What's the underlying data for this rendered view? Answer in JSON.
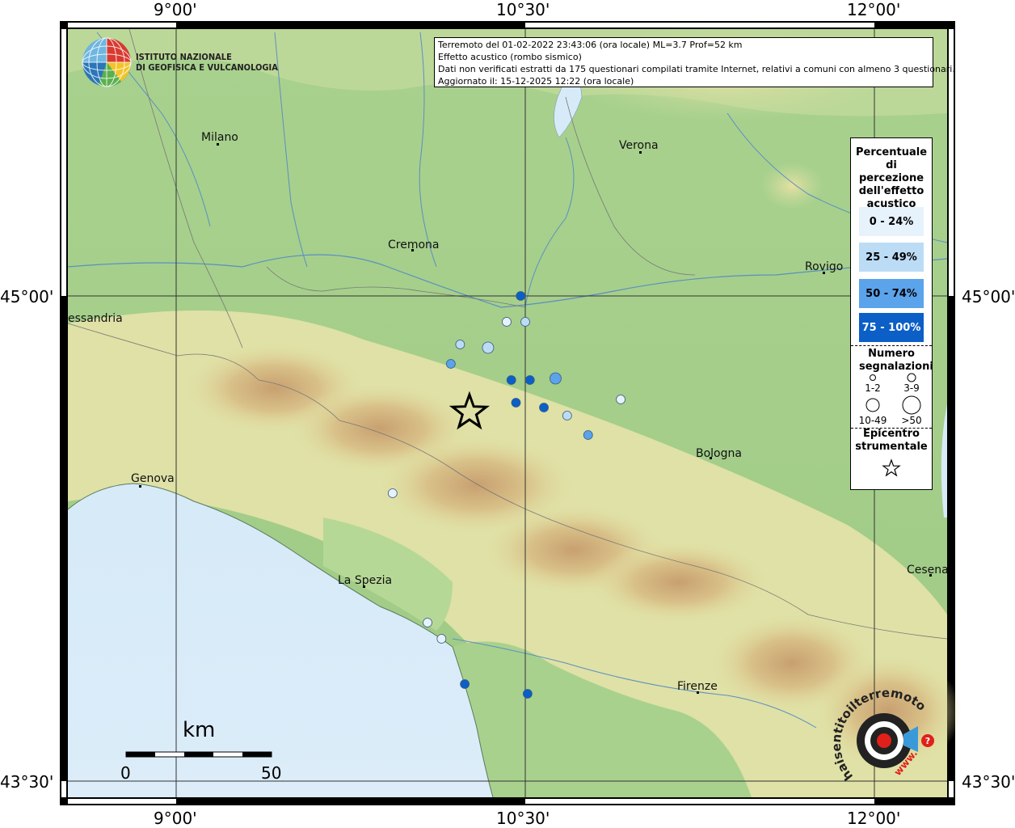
{
  "info_box": {
    "line1": "Terremoto del 01-02-2022 23:43:06 (ora locale) ML=3.7 Prof=52 km",
    "line2": "Effetto acustico (rombo sismico)",
    "line3": "Dati non verificati estratti da 175 questionari compilati tramite Internet, relativi a comuni con almeno 3 questionari.",
    "line4": "Aggiornato il: 15-12-2025 12:22 (ora locale)"
  },
  "logo": {
    "line1": "ISTITUTO NAZIONALE",
    "line2": "DI GEOFISICA E VULCANOLOGIA",
    "icon": "ingv-globe-logo"
  },
  "axes": {
    "top_ticks": [
      "9°00'",
      "10°30'",
      "12°00'"
    ],
    "bottom_ticks": [
      "9°00'",
      "10°30'",
      "12°00'"
    ],
    "left_ticks": [
      "45°00'",
      "43°30'"
    ],
    "right_ticks": [
      "45°00'",
      "43°30'"
    ]
  },
  "cities": [
    "Milano",
    "Verona",
    "Cremona",
    "Rovigo",
    "essandria",
    "Bologna",
    "Genova",
    "La Spezia",
    "Cesena",
    "Firenze"
  ],
  "legend": {
    "title": "Percentuale di percezione dell'effetto acustico",
    "classes": [
      {
        "label": "0 - 24%",
        "color": "#e6f2fc"
      },
      {
        "label": "25 - 49%",
        "color": "#bcdcf6"
      },
      {
        "label": "50 - 74%",
        "color": "#5ba3eb"
      },
      {
        "label": "75 - 100%",
        "color": "#0b5fc6"
      }
    ],
    "count_title": "Numero segnalazioni",
    "counts": [
      "1-2",
      "3-9",
      "10-49",
      ">50"
    ],
    "epicenter_title": "Epicentro strumentale"
  },
  "scale_bar": {
    "unit": "km",
    "start": "0",
    "end": "50"
  },
  "sentito_logo": {
    "text": "haisentitoilterremoto.it",
    "www": "www.",
    "icon": "haisentito-target-logo"
  },
  "points": [
    {
      "lon": 10.48,
      "lat": 45.0,
      "class": 3,
      "count": "1-2"
    },
    {
      "lon": 10.42,
      "lat": 44.92,
      "class": 0,
      "count": "1-2"
    },
    {
      "lon": 10.5,
      "lat": 44.92,
      "class": 1,
      "count": "1-2"
    },
    {
      "lon": 10.22,
      "lat": 44.85,
      "class": 1,
      "count": "1-2"
    },
    {
      "lon": 10.34,
      "lat": 44.84,
      "class": 1,
      "count": "3-9"
    },
    {
      "lon": 10.18,
      "lat": 44.79,
      "class": 2,
      "count": "1-2"
    },
    {
      "lon": 10.44,
      "lat": 44.74,
      "class": 3,
      "count": "1-2"
    },
    {
      "lon": 10.52,
      "lat": 44.74,
      "class": 3,
      "count": "1-2"
    },
    {
      "lon": 10.63,
      "lat": 44.745,
      "class": 2,
      "count": "3-9"
    },
    {
      "lon": 10.46,
      "lat": 44.67,
      "class": 3,
      "count": "1-2"
    },
    {
      "lon": 10.58,
      "lat": 44.655,
      "class": 3,
      "count": "1-2"
    },
    {
      "lon": 10.68,
      "lat": 44.63,
      "class": 1,
      "count": "1-2"
    },
    {
      "lon": 10.91,
      "lat": 44.68,
      "class": 0,
      "count": "1-2"
    },
    {
      "lon": 10.77,
      "lat": 44.57,
      "class": 2,
      "count": "1-2"
    },
    {
      "lon": 9.93,
      "lat": 44.39,
      "class": 0,
      "count": "1-2"
    },
    {
      "lon": 10.08,
      "lat": 43.99,
      "class": 0,
      "count": "1-2"
    },
    {
      "lon": 10.14,
      "lat": 43.94,
      "class": 0,
      "count": "1-2"
    },
    {
      "lon": 10.24,
      "lat": 43.8,
      "class": 3,
      "count": "1-2"
    },
    {
      "lon": 10.51,
      "lat": 43.77,
      "class": 3,
      "count": "1-2"
    }
  ],
  "epicenter": {
    "lon": 10.26,
    "lat": 44.64
  }
}
